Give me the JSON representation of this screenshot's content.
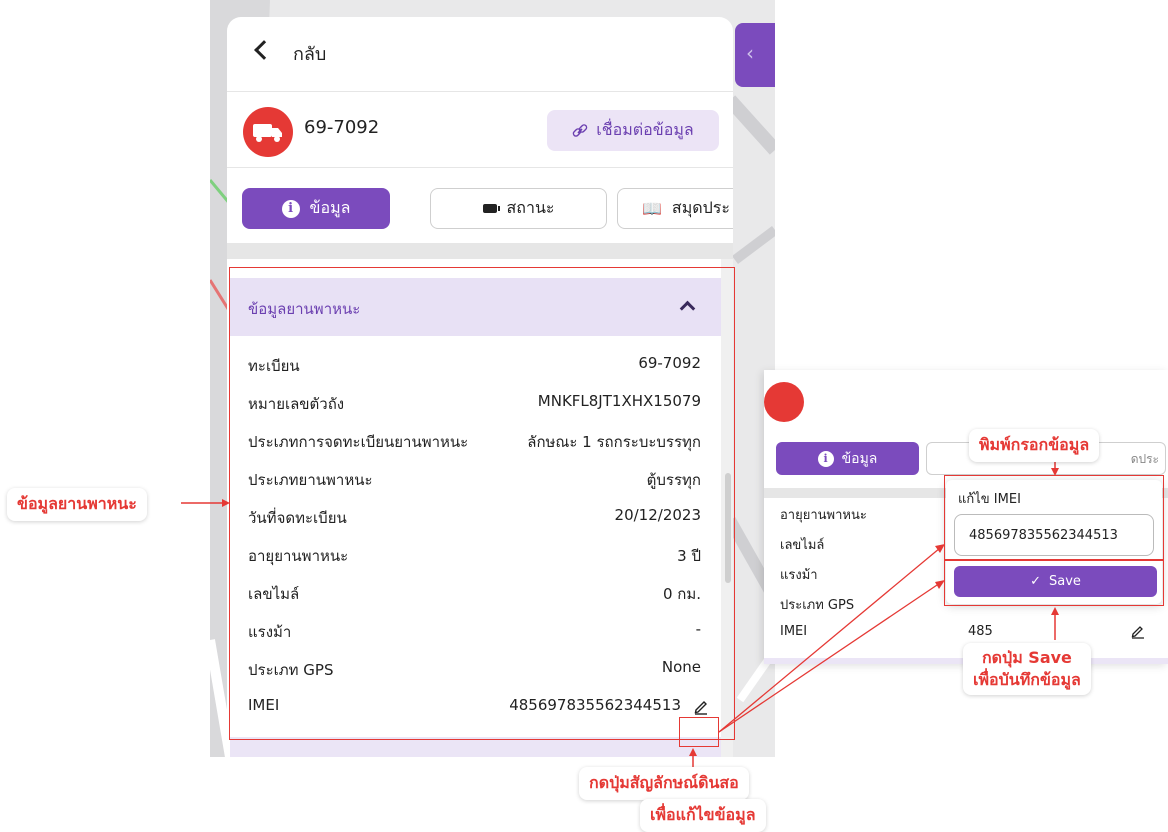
{
  "header": {
    "back_label": "กลับ"
  },
  "vehicle": {
    "plate": "69-7092",
    "link_button": "เชื่อมต่อข้อมูล"
  },
  "tabs": [
    {
      "label": "ข้อมูล",
      "icon": "info-icon",
      "active": true
    },
    {
      "label": "สถานะ",
      "icon": "battery-icon",
      "active": false
    },
    {
      "label": "สมุดประ",
      "icon": "book-icon",
      "active": false
    }
  ],
  "section": {
    "title": "ข้อมูลยานพาหนะ",
    "rows": [
      {
        "label": "ทะเบียน",
        "value": "69-7092"
      },
      {
        "label": "หมายเลขตัวถัง",
        "value": "MNKFL8JT1XHX15079"
      },
      {
        "label": "ประเภทการจดทะเบียนยานพาหนะ",
        "value": "ลักษณะ 1 รถกระบะบรรทุก"
      },
      {
        "label": "ประเภทยานพาหนะ",
        "value": "ตู้บรรทุก"
      },
      {
        "label": "วันที่จดทะเบียน",
        "value": "20/12/2023"
      },
      {
        "label": "อายุยานพาหนะ",
        "value": "3 ปี"
      },
      {
        "label": "เลขไมล์",
        "value": "0 กม."
      },
      {
        "label": "แรงม้า",
        "value": "-"
      },
      {
        "label": "ประเภท GPS",
        "value": "None"
      },
      {
        "label": "IMEI",
        "value": "485697835562344513"
      }
    ]
  },
  "inset": {
    "tab_label": "ข้อมูล",
    "tab2_fragment": "ดประ",
    "rows": [
      "อายุยานพาหนะ",
      "เลขไมล์",
      "แรงม้า",
      "ประเภท GPS",
      "IMEI"
    ],
    "imei_partial": "485",
    "popup": {
      "title": "แก้ไข IMEI",
      "input_value": "485697835562344513",
      "save_label": "Save"
    }
  },
  "annotations": {
    "vehicle_info": "ข้อมูลยานพาหนะ",
    "type_info": "พิมพ์กรอกข้อมูล",
    "press_save_line1": "กดปุ่ม Save",
    "press_save_line2": "เพื่อบันทึกข้อมูล",
    "press_pencil_line1": "กดปุ่มสัญลักษณ์ดินสอ",
    "press_pencil_line2": "เพื่อแก้ไขข้อมูล"
  },
  "colors": {
    "accent": "#7b4bbd",
    "accent_light": "#e8e1f5",
    "annotation_red": "#e53935",
    "vehicle_avatar": "#e53935"
  }
}
